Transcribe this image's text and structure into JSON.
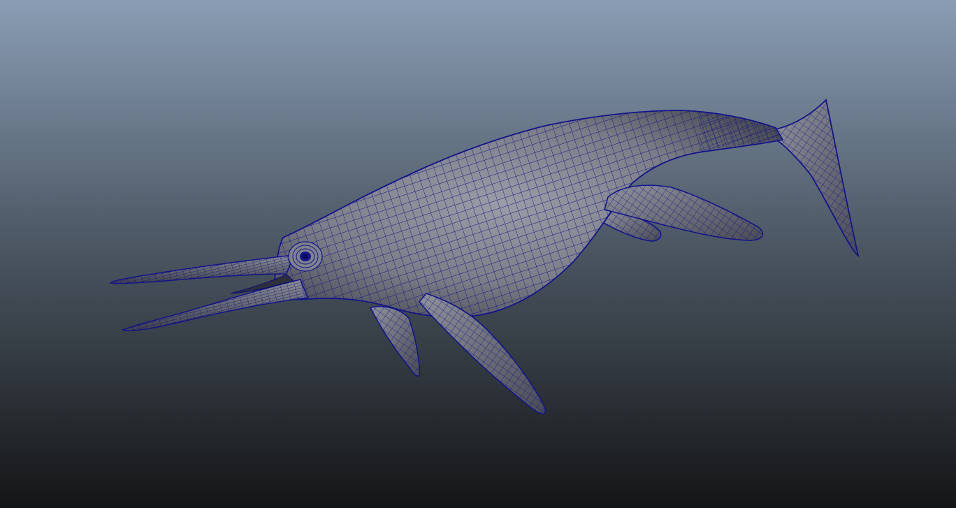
{
  "viewport": {
    "background_top": "#8a9db4",
    "background_bottom": "#141516",
    "mesh_fill": "#7a7d86",
    "mesh_shadow": "#3e4048",
    "mesh_highlight": "#9a9da6",
    "wire_color": "#14148c",
    "wire_color_dense": "#0b0b7a"
  },
  "model": {
    "subject": "ichthyosaur-wireframe-mesh",
    "parts": [
      "body",
      "tail-fin",
      "upper-jaw",
      "lower-jaw",
      "eye",
      "front-flipper-near",
      "front-flipper-far",
      "rear-flipper-near",
      "rear-flipper-far"
    ]
  }
}
